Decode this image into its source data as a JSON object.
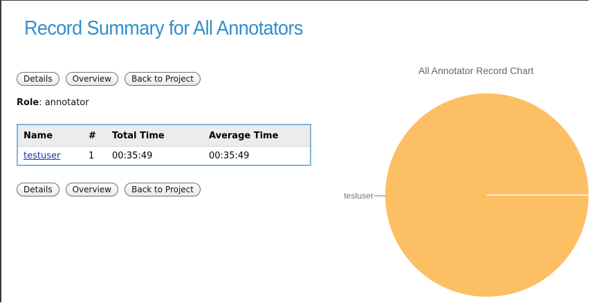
{
  "page": {
    "title": "Record Summary for All Annotators"
  },
  "buttons": {
    "details": "Details",
    "overview": "Overview",
    "back": "Back to Project"
  },
  "role": {
    "label": "Role",
    "value": "annotator"
  },
  "table": {
    "headers": [
      "Name",
      "#",
      "Total Time",
      "Average Time"
    ],
    "rows": [
      {
        "name": "testuser",
        "count": "1",
        "total_time": "00:35:49",
        "average_time": "00:35:49"
      }
    ]
  },
  "chart_data": {
    "type": "pie",
    "title": "All Annotator Record Chart",
    "categories": [
      "testuser"
    ],
    "values": [
      1
    ],
    "colors": [
      "#fdbf63"
    ]
  }
}
